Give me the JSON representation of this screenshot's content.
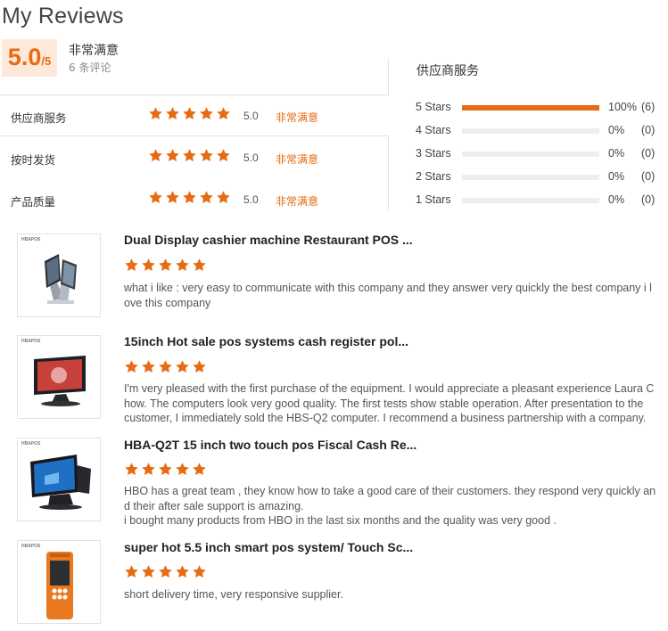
{
  "header": {
    "title": "My Reviews"
  },
  "summary": {
    "score": "5.0",
    "denominator": "/5",
    "overall_label": "非常满意",
    "review_count": "6 条评论"
  },
  "ratings": [
    {
      "label": "供应商服务",
      "stars": 5,
      "score": "5.0",
      "word": "非常满意"
    },
    {
      "label": "按时发货",
      "stars": 5,
      "score": "5.0",
      "word": "非常满意"
    },
    {
      "label": "产品质量",
      "stars": 5,
      "score": "5.0",
      "word": "非常满意"
    }
  ],
  "distribution": {
    "title": "供应商服务",
    "rows": [
      {
        "label": "5  Stars",
        "fraction": 1.0,
        "pct": "100%",
        "count": "(6)"
      },
      {
        "label": "4  Stars",
        "fraction": 0.0,
        "pct": "0%",
        "count": "(0)"
      },
      {
        "label": "3  Stars",
        "fraction": 0.0,
        "pct": "0%",
        "count": "(0)"
      },
      {
        "label": "2  Stars",
        "fraction": 0.0,
        "pct": "0%",
        "count": "(0)"
      },
      {
        "label": "1  Stars",
        "fraction": 0.0,
        "pct": "0%",
        "count": "(0)"
      }
    ]
  },
  "colors": {
    "accent": "#e66b13",
    "star": "#e66b13",
    "track": "#eceef2"
  },
  "reviews": [
    {
      "product_title": "Dual Display cashier machine Restaurant POS ...",
      "stars": 5,
      "image_icon": "dual-display-pos-icon",
      "brand": "HBAPOS",
      "lines": [
        "what i like : very easy to communicate with this company and they answer very quickly the best company i l",
        "ove this company"
      ]
    },
    {
      "product_title": "15inch Hot sale pos systems cash register pol...",
      "stars": 5,
      "image_icon": "pos-monitor-icon",
      "brand": "HBAPOS",
      "lines": [
        "I'm very pleased with the first purchase of the equipment. I would appreciate a pleasant experience Laura C",
        "how. The computers look very good quality. The first tests show stable operation. After presentation to the",
        "customer, I immediately sold the HBS-Q2 computer. I recommend a business partnership with a company."
      ]
    },
    {
      "product_title": "HBA-Q2T 15 inch two touch pos Fiscal Cash Re...",
      "stars": 5,
      "image_icon": "two-screen-pos-icon",
      "brand": "HBAPOS",
      "lines": [
        "HBO has a great team , they know how to take a good care of their customers. they respond very quickly an",
        "d their after sale support is amazing.",
        "i bought many products from HBO in the last six months and the quality was very good ."
      ]
    },
    {
      "product_title": "super hot 5.5 inch smart pos system/ Touch Sc...",
      "stars": 5,
      "image_icon": "handheld-pos-icon",
      "brand": "HBAPOS",
      "lines": [
        "short delivery time, very responsive supplier."
      ]
    }
  ]
}
